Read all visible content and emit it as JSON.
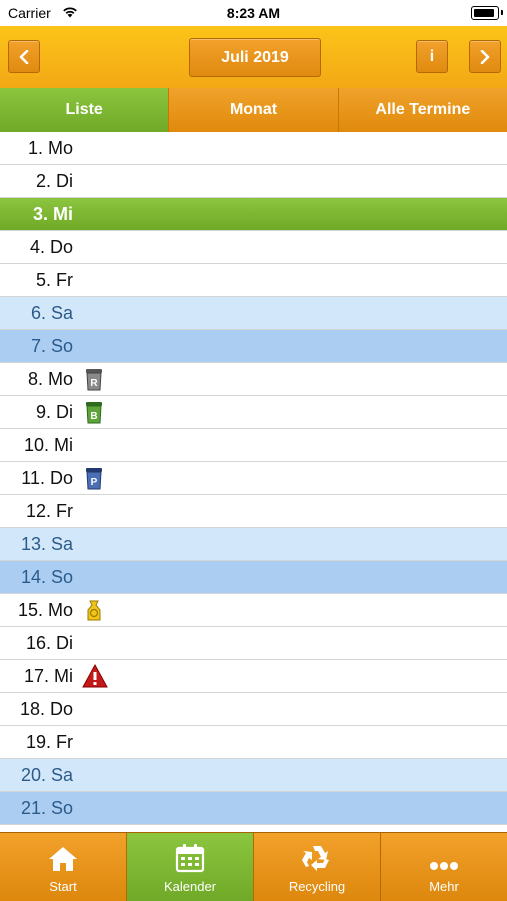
{
  "status": {
    "carrier": "Carrier",
    "time": "8:23 AM"
  },
  "header": {
    "month_label": "Juli 2019",
    "prev_icon": "chevron-left-icon",
    "next_icon": "chevron-right-icon",
    "info_label": "i"
  },
  "tabs": [
    {
      "label": "Liste"
    },
    {
      "label": "Monat"
    },
    {
      "label": "Alle Termine"
    }
  ],
  "days": [
    {
      "label": " 1. Mo",
      "type": "weekday"
    },
    {
      "label": " 2. Di",
      "type": "weekday"
    },
    {
      "label": " 3. Mi",
      "type": "today"
    },
    {
      "label": " 4. Do",
      "type": "weekday"
    },
    {
      "label": " 5. Fr",
      "type": "weekday"
    },
    {
      "label": " 6. Sa",
      "type": "sa"
    },
    {
      "label": " 7. So",
      "type": "so"
    },
    {
      "label": " 8. Mo",
      "type": "weekday",
      "event": "restmuell-bin-icon"
    },
    {
      "label": " 9. Di",
      "type": "weekday",
      "event": "bio-bin-icon"
    },
    {
      "label": "10. Mi",
      "type": "weekday"
    },
    {
      "label": "11. Do",
      "type": "weekday",
      "event": "paper-bin-icon"
    },
    {
      "label": "12. Fr",
      "type": "weekday"
    },
    {
      "label": "13. Sa",
      "type": "sa"
    },
    {
      "label": "14. So",
      "type": "so"
    },
    {
      "label": "15. Mo",
      "type": "weekday",
      "event": "yellow-bag-icon"
    },
    {
      "label": "16. Di",
      "type": "weekday"
    },
    {
      "label": "17. Mi",
      "type": "weekday",
      "event": "warning-icon"
    },
    {
      "label": "18. Do",
      "type": "weekday"
    },
    {
      "label": "19. Fr",
      "type": "weekday"
    },
    {
      "label": "20. Sa",
      "type": "sa"
    },
    {
      "label": "21. So",
      "type": "so"
    }
  ],
  "tabbar": [
    {
      "label": "Start",
      "icon": "home-icon"
    },
    {
      "label": "Kalender",
      "icon": "calendar-icon"
    },
    {
      "label": "Recycling",
      "icon": "recycling-icon"
    },
    {
      "label": "Mehr",
      "icon": "more-icon"
    }
  ],
  "colors": {
    "accent_orange": "#f0a22a",
    "accent_green": "#7ab833",
    "saturday": "#d3e7fb",
    "sunday": "#abcdf2"
  }
}
